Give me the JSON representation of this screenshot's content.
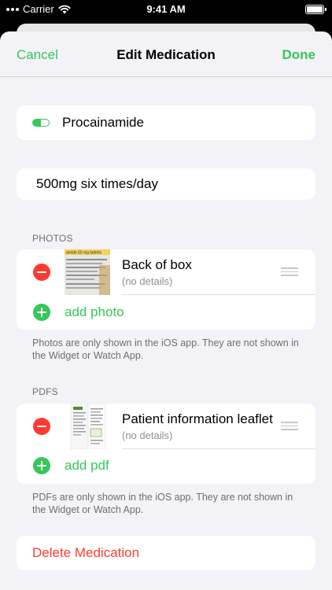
{
  "status_bar": {
    "carrier": "Carrier",
    "time": "9:41 AM"
  },
  "nav": {
    "cancel_label": "Cancel",
    "title": "Edit Medication",
    "done_label": "Done"
  },
  "medication": {
    "name": "Procainamide",
    "dose": "500mg six times/day"
  },
  "photos": {
    "header": "PHOTOS",
    "items": [
      {
        "title": "Back of box",
        "subtitle": "(no details)",
        "thumb_caption": "amide 50 mg tablets"
      }
    ],
    "add_label": "add photo",
    "footer": "Photos are only shown in the iOS app. They are not shown in the Widget or Watch App."
  },
  "pdfs": {
    "header": "PDFS",
    "items": [
      {
        "title": "Patient information leaflet",
        "subtitle": "(no details)"
      }
    ],
    "add_label": "add pdf",
    "footer": "PDFs are only shown in the iOS app. They are not shown in the Widget or Watch App."
  },
  "delete_label": "Delete Medication",
  "colors": {
    "accent": "#34c759",
    "destructive": "#ff3b30",
    "background": "#f2f2f7"
  },
  "icons": {
    "name_row": "pill-icon",
    "remove": "minus-circle-icon",
    "add": "plus-circle-icon",
    "reorder": "reorder-grip-icon"
  }
}
